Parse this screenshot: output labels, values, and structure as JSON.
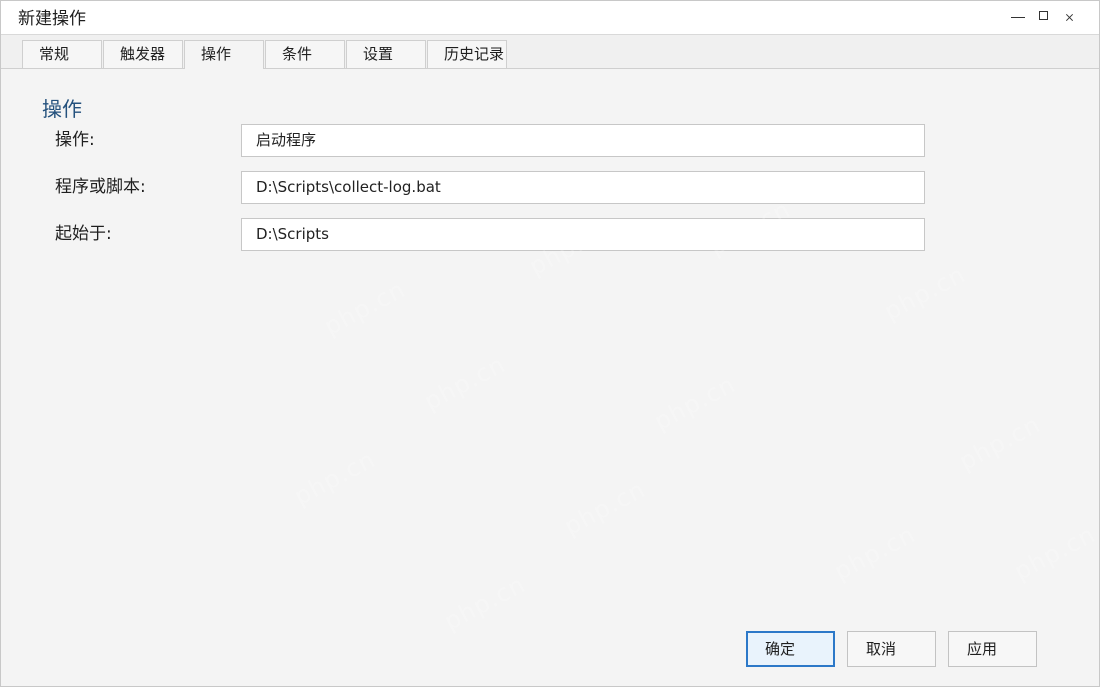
{
  "window": {
    "title": "新建操作"
  },
  "tabs": [
    {
      "label": "常规",
      "active": false
    },
    {
      "label": "触发器",
      "active": false
    },
    {
      "label": "操作",
      "active": true
    },
    {
      "label": "条件",
      "active": false
    },
    {
      "label": "设置",
      "active": false
    },
    {
      "label": "历史记录",
      "active": false
    }
  ],
  "content": {
    "section_title": "操作",
    "fields": [
      {
        "label": "操作:",
        "value": "启动程序"
      },
      {
        "label": "程序或脚本:",
        "value": "D:\\Scripts\\collect-log.bat"
      },
      {
        "label": "起始于:",
        "value": "D:\\Scripts"
      }
    ]
  },
  "buttons": {
    "ok": "确定",
    "cancel": "取消",
    "apply": "应用"
  },
  "watermark": {
    "text": "php.cn"
  },
  "colors": {
    "section_title": "#24517d",
    "primary_border": "#2c78c8",
    "background": "#f4f4f4"
  },
  "icons": {
    "minimize": "minimize-icon",
    "maximize": "maximize-icon",
    "close": "close-icon"
  }
}
